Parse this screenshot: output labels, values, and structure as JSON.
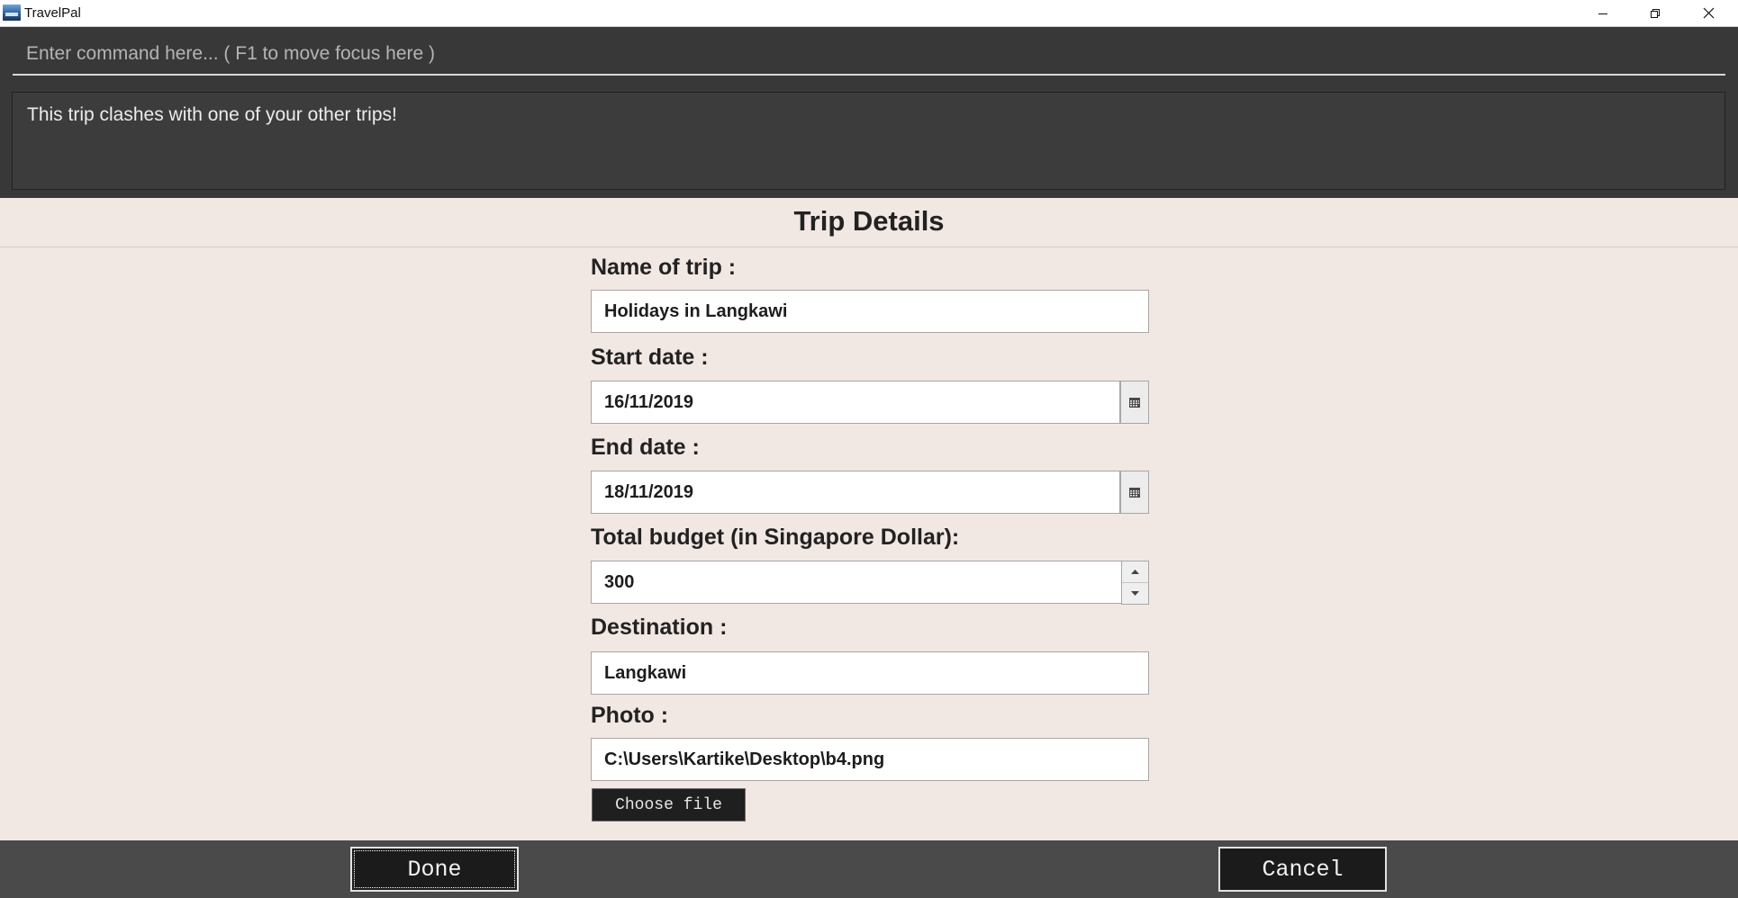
{
  "window": {
    "title": "TravelPal",
    "controls": [
      "minimize-icon",
      "restore-icon",
      "close-icon"
    ]
  },
  "command": {
    "placeholder": "Enter command here... ( F1 to move focus here )",
    "value": ""
  },
  "result": {
    "message": "This trip clashes with one of your other trips!"
  },
  "form": {
    "title": "Trip Details",
    "name_label": "Name of trip :",
    "name_value": "Holidays in Langkawi",
    "start_label": "Start date :",
    "start_value": "16/11/2019",
    "end_label": "End date :",
    "end_value": "18/11/2019",
    "budget_label": "Total budget (in Singapore Dollar):",
    "budget_value": "300",
    "destination_label": "Destination :",
    "destination_value": "Langkawi",
    "photo_label": "Photo :",
    "photo_value": "C:\\Users\\Kartike\\Desktop\\b4.png",
    "choose_file_label": "Choose file"
  },
  "actions": {
    "done_label": "Done",
    "cancel_label": "Cancel"
  },
  "colors": {
    "command_bg": "#383838",
    "form_bg": "#f1e7e3",
    "bottom_bar_bg": "#4a4a4a",
    "button_bg": "#1b1b1b"
  }
}
